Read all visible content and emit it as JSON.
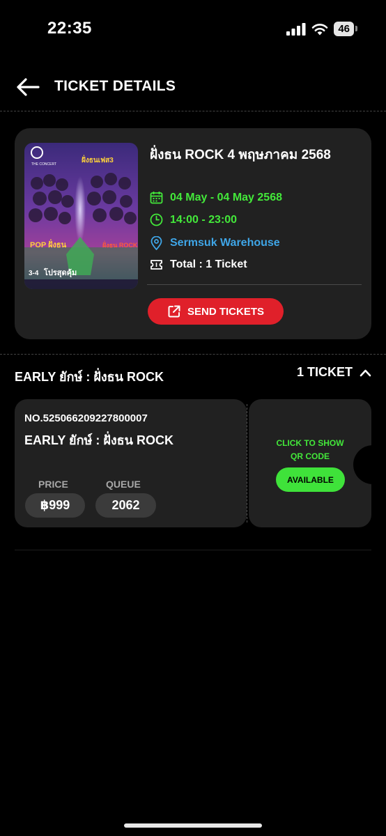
{
  "status_bar": {
    "time": "22:35",
    "battery": "46"
  },
  "header": {
    "title": "TICKET DETAILS"
  },
  "event": {
    "title": "ฝั่งธน ROCK 4 พฤษภาคม 2568",
    "date": "04 May - 04 May 2568",
    "time": "14:00 - 23:00",
    "venue": "Sermsuk Warehouse",
    "total": "Total : 1 Ticket",
    "send_label": "SEND TICKETS",
    "poster": {
      "brand": "THE CONCERT",
      "top_text": "ฝั่งธนเฟส3",
      "left_text": "POP ฝั่งธน",
      "right_text": "ฝั่งธน ROCK",
      "dates": "3-4",
      "bottom_text": "โปรสุดคุ้ม"
    }
  },
  "ticket_section": {
    "title": "EARLY ยักษ์ : ฝั่งธน ROCK",
    "count": "1 TICKET"
  },
  "ticket": {
    "number": "NO.525066209227800007",
    "name": "EARLY ยักษ์ : ฝั่งธน ROCK",
    "price_label": "PRICE",
    "price": "฿999",
    "queue_label": "QUEUE",
    "queue": "2062",
    "qr_text_1": "CLICK TO SHOW",
    "qr_text_2": "QR CODE",
    "status": "AVAILABLE"
  },
  "colors": {
    "background": "#000000",
    "card": "#212121",
    "accent_green": "#43e83a",
    "accent_blue": "#3fa6e8",
    "accent_red": "#e0202a"
  },
  "icons": {
    "back": "arrow-left-icon",
    "calendar": "calendar-icon",
    "clock": "clock-icon",
    "location": "location-pin-icon",
    "ticket": "ticket-icon",
    "send": "external-link-icon",
    "chevron": "chevron-up-icon"
  }
}
